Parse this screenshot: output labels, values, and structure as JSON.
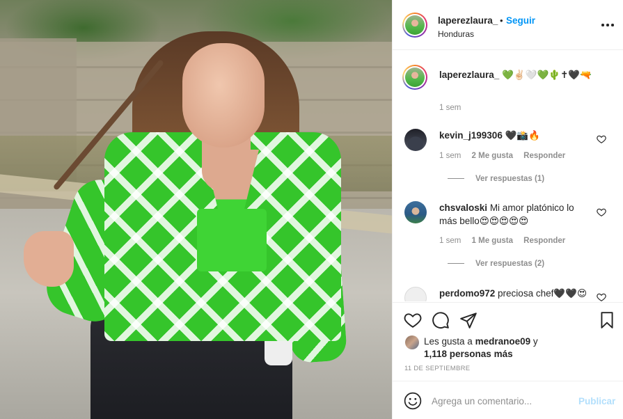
{
  "post": {
    "username": "laperezlaura_",
    "separator": "•",
    "follow_label": "Seguir",
    "location": "Honduras",
    "more_icon": "more-horizontal-icon",
    "image_description_icon": "post-photo"
  },
  "caption": {
    "username": "laperezlaura_",
    "text": "💚✌🏻🤍💚🌵✝🖤🔫",
    "time": "1 sem"
  },
  "comments": [
    {
      "username": "kevin_j199306",
      "text": "🖤📸🔥",
      "time": "1 sem",
      "likes": "2 Me gusta",
      "reply_label": "Responder",
      "view_replies": "Ver respuestas (1)"
    },
    {
      "username": "chsvaloski",
      "text": "Mi amor platónico lo más bello😍😍😍😍😍",
      "time": "1 sem",
      "likes": "1 Me gusta",
      "reply_label": "Responder",
      "view_replies": "Ver respuestas (2)"
    },
    {
      "username": "perdomo972",
      "text": "preciosa chef🖤🖤😍"
    }
  ],
  "actions": {
    "like_icon": "heart-icon",
    "comment_icon": "comment-icon",
    "share_icon": "share-icon",
    "save_icon": "bookmark-icon"
  },
  "likes": {
    "prefix": "Les gusta a",
    "user": "medranoe09",
    "connector": "y",
    "count": "1,118 personas más"
  },
  "date": "11 DE SEPTIEMBRE",
  "composer": {
    "placeholder": "Agrega un comentario...",
    "publish_label": "Publicar",
    "emoji_icon": "smiley-icon"
  },
  "colors": {
    "link": "#0095f6",
    "publish_disabled": "#b2dffc",
    "muted": "#8e8e8e",
    "text": "#262626"
  }
}
